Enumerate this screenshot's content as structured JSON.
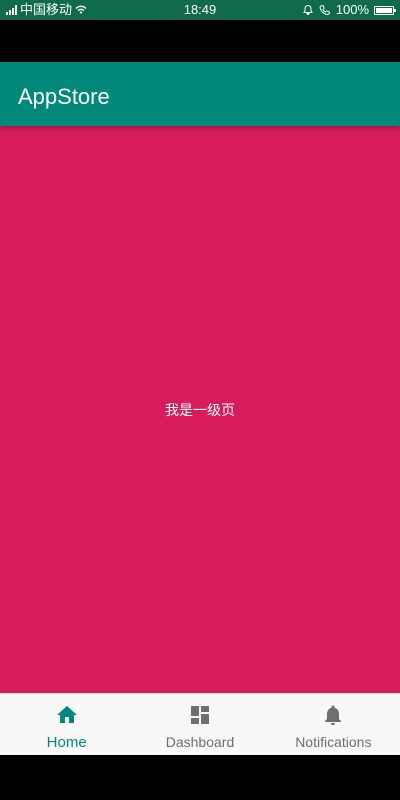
{
  "status_bar": {
    "carrier": "中国移动",
    "time": "18:49",
    "battery": "100%",
    "battery_level": 1.0
  },
  "app_bar": {
    "title": "AppStore"
  },
  "content": {
    "text": "我是一级页"
  },
  "bottom_nav": {
    "items": [
      {
        "label": "Home",
        "icon": "home-icon",
        "active": true
      },
      {
        "label": "Dashboard",
        "icon": "dashboard-icon",
        "active": false
      },
      {
        "label": "Notifications",
        "icon": "bell-icon",
        "active": false
      }
    ]
  },
  "colors": {
    "status_bar": "#0f6b4a",
    "app_bar": "#00897b",
    "content": "#d81b5b",
    "active_tab": "#00897b",
    "inactive_tab": "#6e6e6e",
    "nav_background": "#f8f8f8"
  }
}
